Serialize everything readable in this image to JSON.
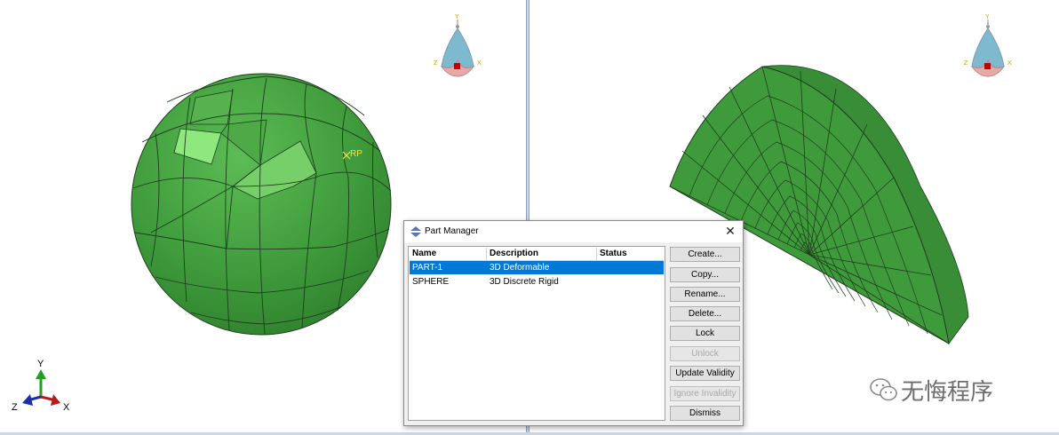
{
  "left_viewport": {
    "reference_point_label": "RP",
    "triad_labels": {
      "y": "Y",
      "x": "X",
      "z": "Z"
    },
    "view_cube_labels": {
      "y": "Y",
      "x": "X",
      "z": "Z"
    }
  },
  "right_viewport": {
    "view_cube_labels": {
      "y": "Y",
      "x": "X",
      "z": "Z"
    }
  },
  "dialog": {
    "title": "Part Manager",
    "close_glyph": "✕",
    "columns": [
      "Name",
      "Description",
      "Status"
    ],
    "rows": [
      {
        "name": "PART-1",
        "description": "3D Deformable",
        "status": "",
        "selected": true
      },
      {
        "name": "SPHERE",
        "description": "3D Discrete Rigid",
        "status": "",
        "selected": false
      }
    ],
    "buttons": [
      {
        "label": "Create...",
        "enabled": true
      },
      {
        "label": "Copy...",
        "enabled": true
      },
      {
        "label": "Rename...",
        "enabled": true
      },
      {
        "label": "Delete...",
        "enabled": true
      },
      {
        "label": "Lock",
        "enabled": true
      },
      {
        "label": "Unlock",
        "enabled": false
      },
      {
        "label": "Update Validity",
        "enabled": true
      },
      {
        "label": "Ignore Invalidity",
        "enabled": false
      },
      {
        "label": "Dismiss",
        "enabled": true
      }
    ]
  },
  "watermark": {
    "text": "无悔程序"
  },
  "colors": {
    "mesh_green": "#3e9a3a",
    "selection_blue": "#0078d7",
    "divider": "#c9d7e6"
  },
  "icons": [
    "part-manager-icon",
    "close-icon",
    "wechat-logo-icon"
  ]
}
